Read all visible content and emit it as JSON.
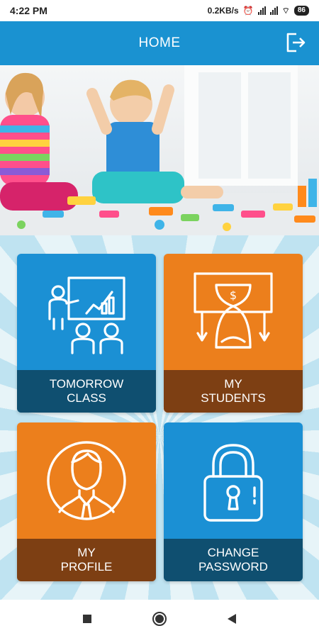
{
  "status_bar": {
    "time": "4:22 PM",
    "network_speed": "0.2KB/s",
    "battery": "86"
  },
  "app_bar": {
    "title": "HOME",
    "logout_icon": "logout-icon"
  },
  "hero": {
    "description_icon": "kids-playing-image"
  },
  "tiles": [
    {
      "line1": "TOMORROW",
      "line2": "CLASS",
      "icon": "classroom-icon",
      "color": "#1b90d4"
    },
    {
      "line1": "MY",
      "line2": "STUDENTS",
      "icon": "money-hourglass-icon",
      "color": "#ec7f1c"
    },
    {
      "line1": "MY",
      "line2": "PROFILE",
      "icon": "profile-icon",
      "color": "#ec7f1c"
    },
    {
      "line1": "CHANGE",
      "line2": "PASSWORD",
      "icon": "padlock-icon",
      "color": "#1b90d4"
    }
  ],
  "nav": {
    "recents": "square-icon",
    "home": "circle-icon",
    "back": "triangle-back-icon"
  },
  "colors": {
    "primary": "#1a92d1",
    "accent": "#ec7f1c"
  }
}
